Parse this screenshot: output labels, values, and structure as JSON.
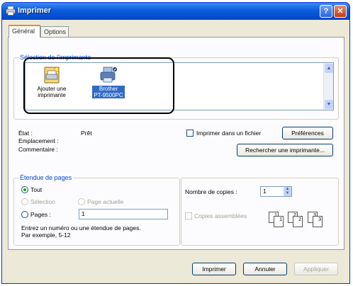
{
  "window": {
    "title": "Imprimer"
  },
  "titlebar": {
    "help_glyph": "?",
    "close_glyph": "✕"
  },
  "tabs": [
    {
      "label": "Général"
    },
    {
      "label": "Options"
    }
  ],
  "printer_selection": {
    "legend": "Sélection de l'imprimante",
    "items": [
      {
        "label_line1": "Ajouter une",
        "label_line2": "imprimante",
        "icon": "add-printer-icon"
      },
      {
        "label_line1": "Brother",
        "label_line2": "PT-9500PC",
        "icon": "printer-icon",
        "selected": true
      }
    ]
  },
  "status": {
    "state_label": "État :",
    "state_value": "Prêt",
    "location_label": "Emplacement :",
    "comment_label": "Commentaire :",
    "print_to_file": "Imprimer dans un fichier",
    "preferences_button": "Préférences",
    "find_printer_button": "Rechercher une imprimante..."
  },
  "page_range": {
    "legend": "Étendue de pages",
    "all": "Tout",
    "selection": "Sélection",
    "current_page": "Page actuelle",
    "pages": "Pages :",
    "pages_value": "1",
    "hint_line1": "Entrez un numéro ou une étendue de pages.",
    "hint_line2": "Par exemple, 5-12"
  },
  "copies": {
    "count_label": "Nombre de copies :",
    "count_value": "1",
    "collate_label": "Copies assemblées",
    "collate_icons": [
      "1",
      "1",
      "2",
      "2",
      "3",
      "3"
    ]
  },
  "footer": {
    "print_button": "Imprimer",
    "cancel_button": "Annuler",
    "apply_button": "Appliquer"
  },
  "colors": {
    "title_blue": "#0a5ddc",
    "legend_blue": "#0046d5",
    "selected_bg": "#316ac5"
  }
}
